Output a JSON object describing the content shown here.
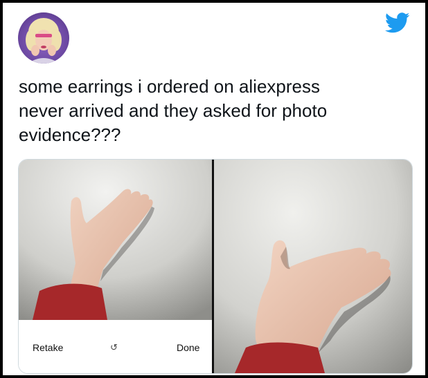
{
  "tweet": {
    "text_lines": [
      "some earrings i ordered on aliexpress",
      "never arrived and they asked for photo",
      "evidence???"
    ]
  },
  "camera": {
    "retake_label": "Retake",
    "done_label": "Done",
    "rotate_icon": "↺"
  },
  "icons": {
    "brand": "twitter-bird-icon",
    "avatar": "profile-avatar"
  },
  "colors": {
    "twitter_blue": "#1d9bf0",
    "sleeve_red": "#a6282a"
  }
}
